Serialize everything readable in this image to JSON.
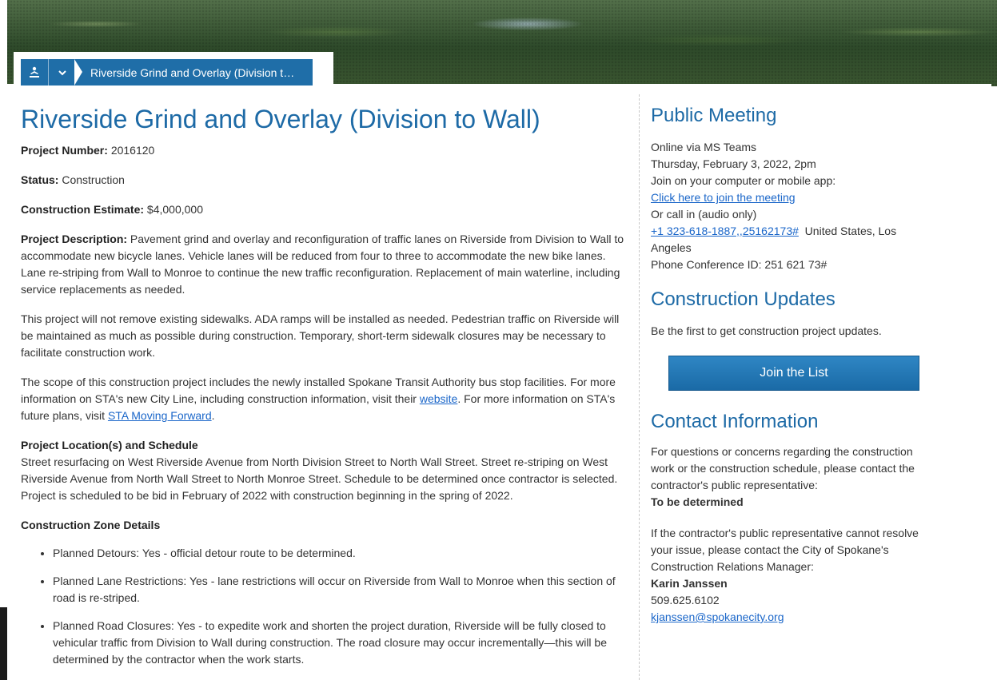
{
  "breadcrumb": {
    "home_icon": "person-icon",
    "chevron_icon": "chevron-down-icon",
    "label": "Riverside Grind and Overlay (Division t…"
  },
  "main": {
    "title": "Riverside Grind and Overlay (Division to Wall)",
    "project_number_label": "Project Number:",
    "project_number": "2016120",
    "status_label": "Status:",
    "status": "Construction",
    "estimate_label": "Construction Estimate:",
    "estimate": "$4,000,000",
    "description_label": "Project Description:",
    "description": "Pavement grind and overlay and reconfiguration of traffic lanes on Riverside from Division to Wall to accommodate new bicycle lanes. Vehicle lanes will be reduced from four to three to accommodate the new bike lanes. Lane re-striping from Wall to Monroe to continue the new traffic reconfiguration. Replacement of main waterline, including service replacements as needed.",
    "sidewalk_paragraph": "This project will not remove existing sidewalks. ADA ramps will be installed as needed. Pedestrian traffic on Riverside will be maintained as much as possible during construction. Temporary, short-term sidewalk closures may be necessary to facilitate construction work.",
    "sta_text_1": "The scope of this construction project includes the newly installed Spokane Transit Authority bus stop facilities. For more information on STA's new City Line, including construction information, visit their ",
    "sta_link_1": "website",
    "sta_text_2": ". For more information on STA's future plans, visit ",
    "sta_link_2": "STA Moving Forward",
    "sta_text_3": ".",
    "location_heading": "Project Location(s) and Schedule",
    "location_text": "Street resurfacing on West Riverside Avenue from North Division Street to North Wall Street. Street re-striping on West Riverside Avenue from North Wall Street to North Monroe Street. Schedule to be determined once contractor is selected. Project is scheduled to be bid in February of 2022 with construction beginning in the spring of 2022.",
    "zone_heading": "Construction Zone Details",
    "zone_items": [
      "Planned Detours: Yes - official detour route to be determined.",
      "Planned Lane Restrictions: Yes - lane restrictions will occur on Riverside from Wall to Monroe when this section of road is re-striped.",
      "Planned Road Closures: Yes - to expedite work and shorten the project duration, Riverside will be fully closed to vehicular traffic from Division to Wall during construction. The road closure may occur incrementally—this will be determined by the contractor when the work starts."
    ]
  },
  "sidebar": {
    "meeting": {
      "heading": "Public Meeting",
      "line1": "Online via MS Teams",
      "line2": "Thursday, February 3, 2022, 2pm",
      "line3": "Join on your computer or mobile app:",
      "join_link": "Click here to join the meeting",
      "line4": "Or call in (audio only)",
      "phone_link": "+1 323-618-1887,,25162173#",
      "phone_location": "  United States, Los Angeles",
      "conference_id": "Phone Conference ID: 251 621 73#"
    },
    "updates": {
      "heading": "Construction Updates",
      "text": "Be the first to get construction project updates.",
      "button": "Join the List"
    },
    "contact": {
      "heading": "Contact Information",
      "text1": "For questions or concerns regarding the construction work or the construction schedule, please contact the contractor's public representative:",
      "rep": "To be determined",
      "text2": "If the contractor's public representative cannot resolve your issue, please contact the City of Spokane's Construction Relations Manager:",
      "manager_name": "Karin Janssen",
      "manager_phone": "509.625.6102",
      "manager_email": "kjanssen@spokanecity.org"
    }
  }
}
